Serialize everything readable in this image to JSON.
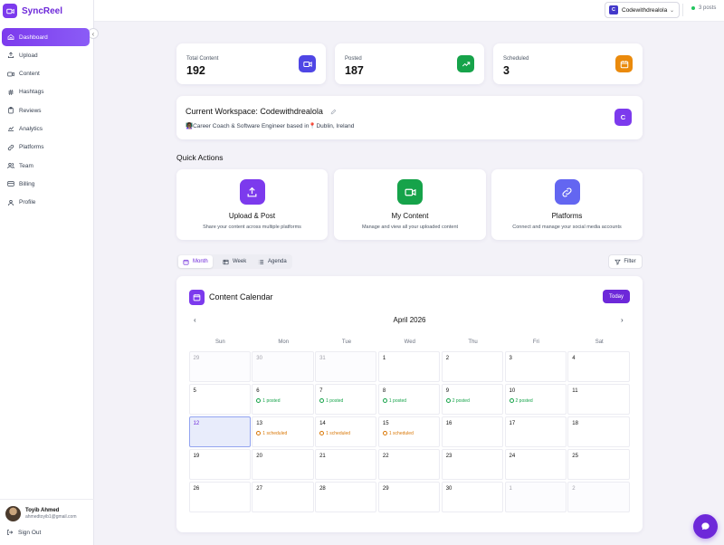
{
  "brand": {
    "name": "SyncReel"
  },
  "sidebar": {
    "items": [
      {
        "label": "Dashboard",
        "icon": "home-icon",
        "active": true
      },
      {
        "label": "Upload",
        "icon": "upload-icon"
      },
      {
        "label": "Content",
        "icon": "video-icon"
      },
      {
        "label": "Hashtags",
        "icon": "hash-icon"
      },
      {
        "label": "Reviews",
        "icon": "clipboard-icon"
      },
      {
        "label": "Analytics",
        "icon": "chart-icon"
      },
      {
        "label": "Platforms",
        "icon": "link-icon"
      },
      {
        "label": "Team",
        "icon": "users-icon"
      },
      {
        "label": "Billing",
        "icon": "credit-card-icon"
      },
      {
        "label": "Profile",
        "icon": "user-icon"
      }
    ],
    "user": {
      "name": "Toyib Ahmed",
      "email": "ahmedtoyib1@gmail.com"
    },
    "signout_label": "Sign Out"
  },
  "topbar": {
    "workspace_badge": "C",
    "workspace_name": "Codewithdrealola",
    "posts_count": "3 posts"
  },
  "stats": [
    {
      "label": "Total Content",
      "value": "192",
      "color": "#4f46e5"
    },
    {
      "label": "Posted",
      "value": "187",
      "color": "#16a34a"
    },
    {
      "label": "Scheduled",
      "value": "3",
      "color": "#ea8a0c"
    }
  ],
  "workspace": {
    "title": "Current Workspace: Codewithdrealola",
    "description": "👩🏾‍🏫Career Coach & Software Engineer based in📍Dublin, Ireland",
    "avatar": "C"
  },
  "quick_actions": {
    "title": "Quick Actions",
    "items": [
      {
        "title": "Upload & Post",
        "desc": "Share your content across multiple platforms",
        "color": "#7c3aed"
      },
      {
        "title": "My Content",
        "desc": "Manage and view all your uploaded content",
        "color": "#16a34a"
      },
      {
        "title": "Platforms",
        "desc": "Connect and manage your social media accounts",
        "color": "#6366f1"
      }
    ]
  },
  "view_tabs": {
    "month": "Month",
    "week": "Week",
    "agenda": "Agenda",
    "active": "Month"
  },
  "filter_label": "Filter",
  "calendar": {
    "title": "Content Calendar",
    "today_label": "Today",
    "month_label": "April 2026",
    "weekdays": [
      "Sun",
      "Mon",
      "Tue",
      "Wed",
      "Thu",
      "Fri",
      "Sat"
    ],
    "cells": [
      {
        "day": "29",
        "out": true
      },
      {
        "day": "30",
        "out": true
      },
      {
        "day": "31",
        "out": true
      },
      {
        "day": "1"
      },
      {
        "day": "2"
      },
      {
        "day": "3"
      },
      {
        "day": "4"
      },
      {
        "day": "5"
      },
      {
        "day": "6",
        "tag": "1 posted",
        "kind": "posted"
      },
      {
        "day": "7",
        "tag": "1 posted",
        "kind": "posted"
      },
      {
        "day": "8",
        "tag": "1 posted",
        "kind": "posted"
      },
      {
        "day": "9",
        "tag": "2 posted",
        "kind": "posted"
      },
      {
        "day": "10",
        "tag": "2 posted",
        "kind": "posted"
      },
      {
        "day": "11"
      },
      {
        "day": "12",
        "today": true
      },
      {
        "day": "13",
        "tag": "1 scheduled",
        "kind": "scheduled"
      },
      {
        "day": "14",
        "tag": "1 scheduled",
        "kind": "scheduled"
      },
      {
        "day": "15",
        "tag": "1 scheduled",
        "kind": "scheduled"
      },
      {
        "day": "16"
      },
      {
        "day": "17"
      },
      {
        "day": "18"
      },
      {
        "day": "19"
      },
      {
        "day": "20"
      },
      {
        "day": "21"
      },
      {
        "day": "22"
      },
      {
        "day": "23"
      },
      {
        "day": "24"
      },
      {
        "day": "25"
      },
      {
        "day": "26"
      },
      {
        "day": "27"
      },
      {
        "day": "28"
      },
      {
        "day": "29"
      },
      {
        "day": "30"
      },
      {
        "day": "1",
        "out": true
      },
      {
        "day": "2",
        "out": true
      }
    ]
  }
}
